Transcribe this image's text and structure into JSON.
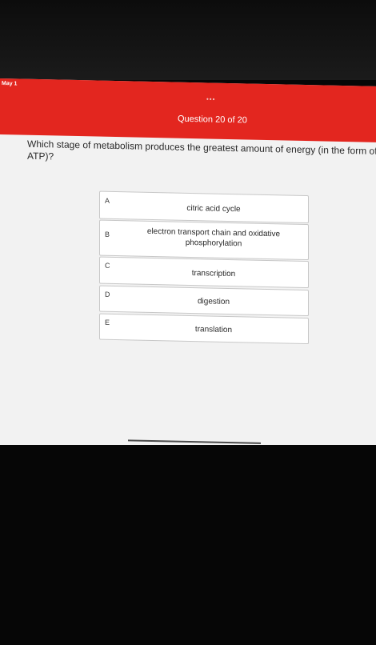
{
  "status_bar": {
    "date": "May 1"
  },
  "header": {
    "dots": "•••",
    "question_counter": "Question 20 of 20"
  },
  "question": {
    "text": "Which stage of metabolism produces the greatest amount of energy (in the form of ATP)?"
  },
  "answers": [
    {
      "letter": "A",
      "text": "citric acid cycle"
    },
    {
      "letter": "B",
      "text": "electron transport chain and oxidative phosphorylation"
    },
    {
      "letter": "C",
      "text": "transcription"
    },
    {
      "letter": "D",
      "text": "digestion"
    },
    {
      "letter": "E",
      "text": "translation"
    }
  ],
  "colors": {
    "header_red": "#e3261f",
    "screen_bg": "#f2f2f2",
    "surround": "#070707"
  }
}
